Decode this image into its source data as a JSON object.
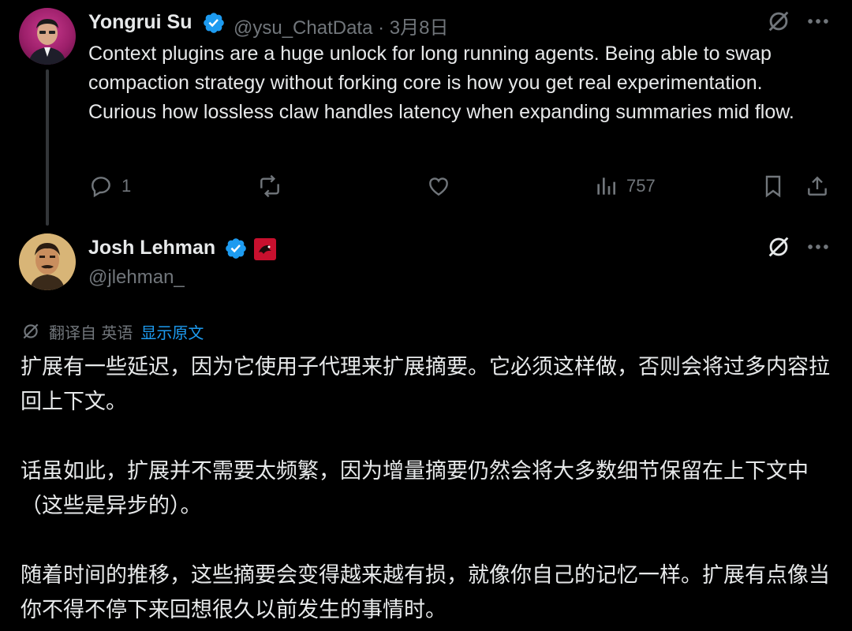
{
  "reply": {
    "author_name": "Yongrui Su",
    "handle_date": "@ysu_ChatData · 3月8日",
    "text": "Context plugins are a huge unlock for long running agents. Being able to swap compaction strategy without forking core is how you get real experimentation. Curious how lossless claw handles latency when expanding summaries mid flow.",
    "reply_count": "1",
    "views_count": "757",
    "avatar_icon": "avatar-photo",
    "icons": {
      "reply": "speech-bubble-icon",
      "repost": "repost-arrows-icon",
      "like": "heart-icon",
      "views": "bar-chart-icon",
      "bookmark": "bookmark-icon",
      "share": "share-upload-icon",
      "grok": "grok-slash-circle-icon",
      "more": "more-dots-icon"
    }
  },
  "main": {
    "author_name": "Josh Lehman",
    "handle": "@jlehman_",
    "translate": {
      "label": "翻译自 英语",
      "show_original": "显示原文"
    },
    "paragraphs": [
      "扩展有一些延迟，因为它使用子代理来扩展摘要。它必须这样做，否则会将过多内容拉回上下文。",
      "话虽如此，扩展并不需要太频繁，因为增量摘要仍然会将大多数细节保留在上下文中（这些是异步的）。",
      "随着时间的推移，这些摘要会变得越来越有损，就像你自己的记忆一样。扩展有点像当你不得不停下来回想很久以前发生的事情时。"
    ]
  },
  "colors": {
    "background": "#000000",
    "text_primary": "#e7e9ea",
    "text_secondary": "#71767b",
    "accent_blue": "#1d9bf0",
    "badge_red": "#c8102e"
  }
}
